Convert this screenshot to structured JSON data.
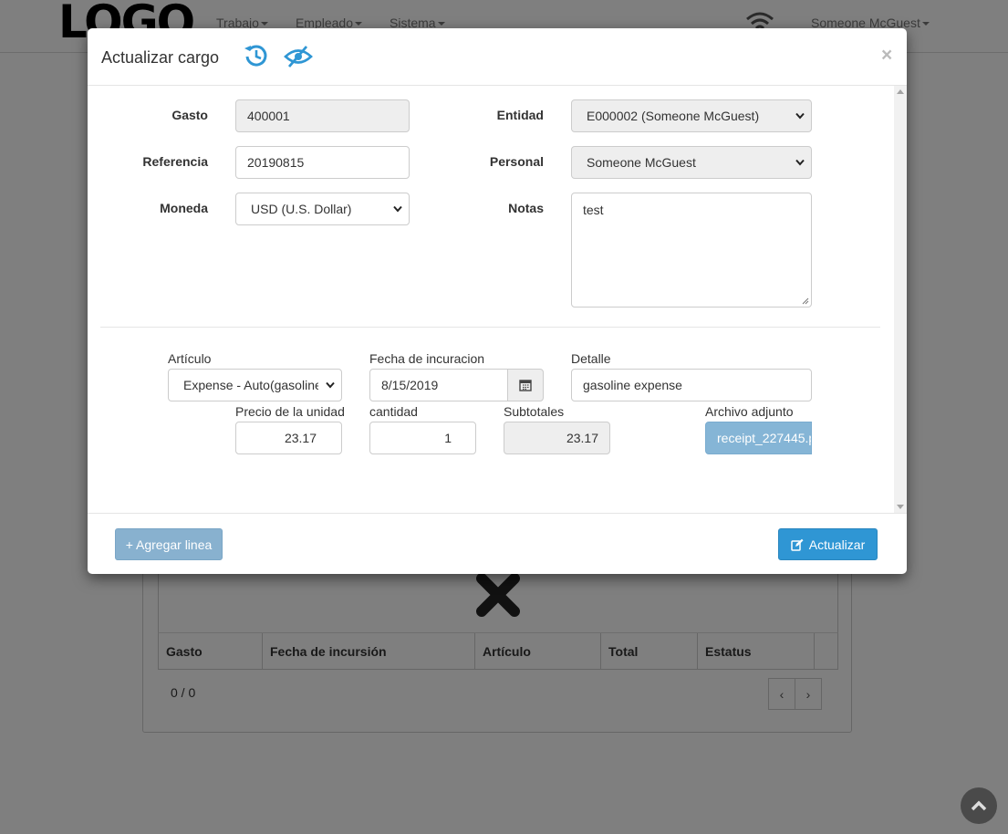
{
  "navbar": {
    "logo": "LOGO",
    "menu": [
      {
        "label": "Trabajo"
      },
      {
        "label": "Empleado"
      },
      {
        "label": "Sistema"
      }
    ],
    "user": "Someone McGuest",
    "wifi_icon": "wifi-icon"
  },
  "background": {
    "table_headers": [
      "Gasto",
      "Fecha de incursión",
      "Artículo",
      "Total",
      "Estatus"
    ],
    "count": "0 / 0",
    "pager_prev": "‹",
    "pager_next": "›"
  },
  "modal": {
    "title": "Actualizar cargo",
    "icons": [
      "history-icon",
      "eye-slash-icon"
    ],
    "close": "×",
    "fields": {
      "gasto_label": "Gasto",
      "gasto_value": "400001",
      "referencia_label": "Referencia",
      "referencia_value": "20190815",
      "moneda_label": "Moneda",
      "moneda_value": "USD (U.S. Dollar)",
      "entidad_label": "Entidad",
      "entidad_value": "E000002 (Someone McGuest)",
      "personal_label": "Personal",
      "personal_value": "Someone McGuest",
      "notas_label": "Notas",
      "notas_value": "test"
    },
    "line": {
      "articulo_label": "Artículo",
      "articulo_value": "Expense - Auto(gasoline",
      "fecha_label": "Fecha de incuracion",
      "fecha_value": "8/15/2019",
      "detalle_label": "Detalle",
      "detalle_value": "gasoline expense",
      "precio_label": "Precio de la unidad",
      "precio_value": "23.17",
      "cantidad_label": "cantidad",
      "cantidad_value": "1",
      "subtotal_label": "Subtotales",
      "subtotal_value": "23.17",
      "archivo_label": "Archivo adjunto",
      "archivo_value": "receipt_227445.p"
    },
    "footer": {
      "add_line": "+ Agregar linea",
      "update": "Actualizar"
    }
  },
  "colors": {
    "primary": "#2f96d4",
    "primary_disabled": "#88b1cf",
    "icon_blue": "#2f96d4"
  }
}
